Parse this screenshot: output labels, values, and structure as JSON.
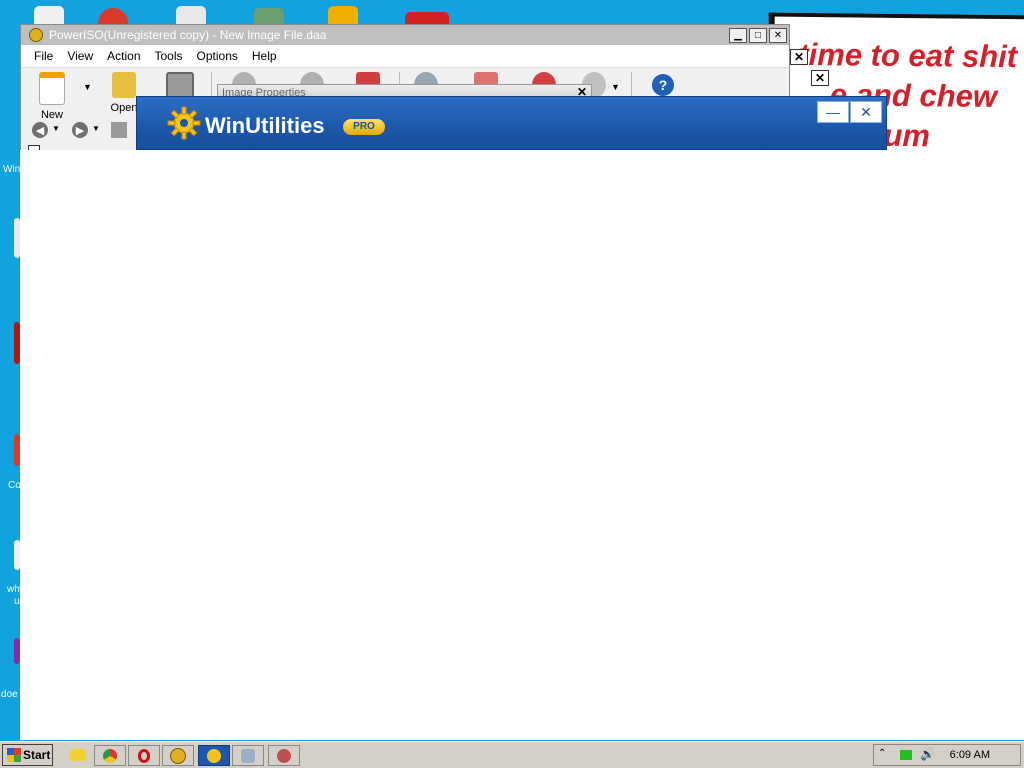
{
  "desktop": {
    "labels": [
      "Win",
      "Co",
      "wh",
      "u",
      "doe"
    ],
    "note_lines": [
      "time to eat shit",
      "e and chew",
      "um"
    ]
  },
  "poweriso": {
    "title": "PowerISO(Unregistered copy) - New Image File.daa",
    "menu": [
      "File",
      "View",
      "Action",
      "Tools",
      "Options",
      "Help"
    ],
    "toolbar": {
      "new_label": "New",
      "open_label": "Open"
    },
    "dialog_title": "Image Properties"
  },
  "winutilities": {
    "name": "WinUtilities",
    "badge": "PRO"
  },
  "taskbar": {
    "start_label": "Start",
    "clock": "6:09 AM"
  },
  "colors": {
    "desktop_bg": "#12a2e0",
    "winu_blue": "#1b57aa",
    "note_red": "#d4202a"
  }
}
